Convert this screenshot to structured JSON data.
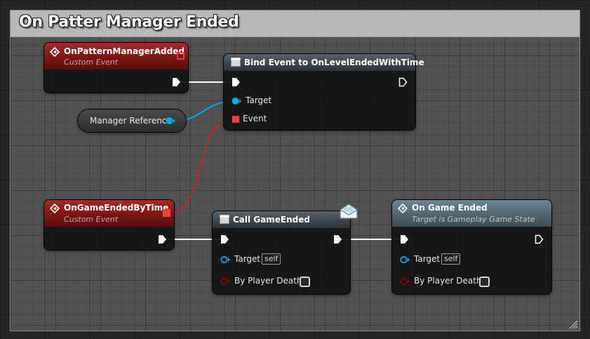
{
  "comment": {
    "title": "On Patter Manager Ended"
  },
  "nodes": {
    "pattern_added": {
      "title": "OnPatternManagerAdded",
      "subtitle": "Custom Event"
    },
    "bind_event": {
      "title": "Bind Event to OnLevelEndedWithTime",
      "pins": {
        "target": "Target",
        "event": "Event"
      }
    },
    "manager_ref": {
      "label": "Manager Reference"
    },
    "game_ended_by_time": {
      "title": "OnGameEndedByTime",
      "subtitle": "Custom Event"
    },
    "call_game_ended": {
      "title": "Call GameEnded",
      "pins": {
        "target": "Target",
        "target_default": "self",
        "by_player_death": "By Player Death"
      }
    },
    "on_game_ended": {
      "title": "On Game Ended",
      "subtitle": "Target is Gameplay Game State",
      "pins": {
        "target": "Target",
        "target_default": "self",
        "by_player_death": "By Player Death"
      }
    }
  },
  "colors": {
    "exec_wire": "#ffffff",
    "object_pin": "#00a8f2",
    "delegate_pin": "#f04040",
    "bool_pin": "#8c0000",
    "event_header": "#8a1a1a",
    "function_header": "#444b52",
    "event_dispatch_header": "#5a7079"
  }
}
